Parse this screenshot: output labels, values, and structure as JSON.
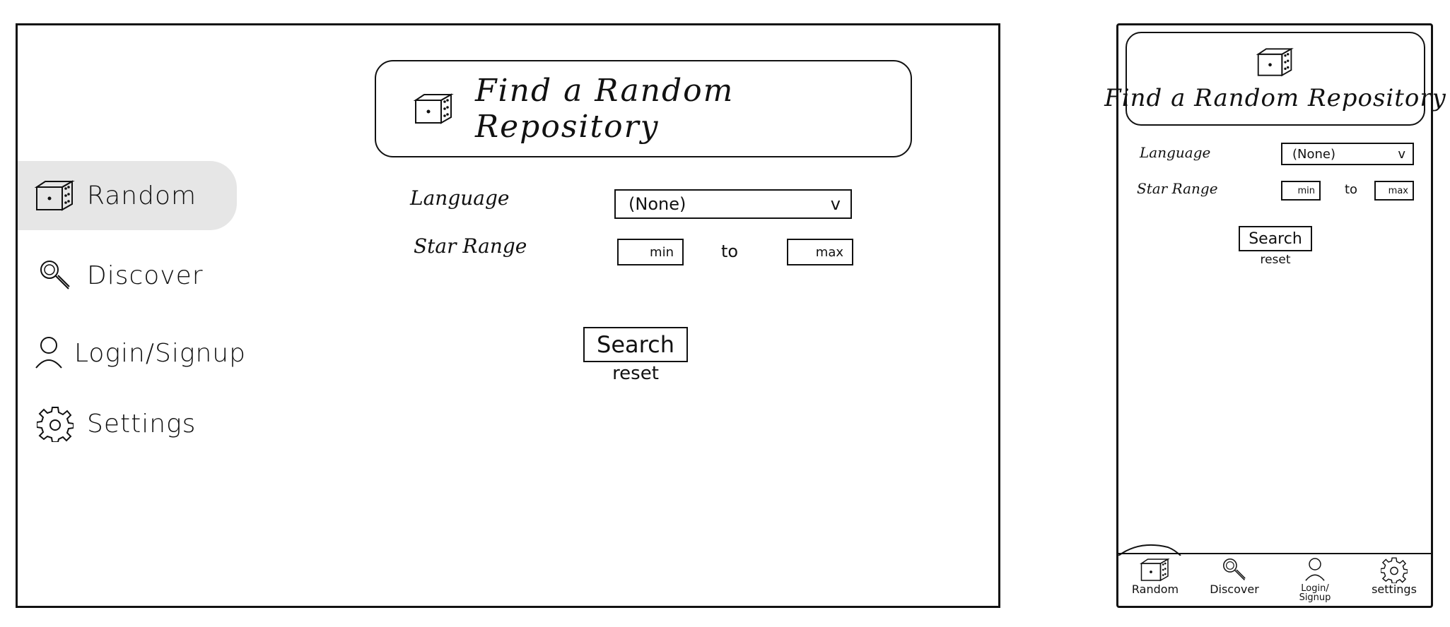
{
  "desktop": {
    "sidebar": {
      "items": [
        {
          "label": "Random",
          "icon": "dice-icon",
          "active": true
        },
        {
          "label": "Discover",
          "icon": "search-icon",
          "active": false
        },
        {
          "label": "Login/Signup",
          "icon": "user-icon",
          "active": false
        },
        {
          "label": "Settings",
          "icon": "gear-icon",
          "active": false
        }
      ]
    },
    "title": "Find a Random Repository",
    "form": {
      "language_label": "Language",
      "language_value": "(None)",
      "language_chevron": "v",
      "star_range_label": "Star Range",
      "min_placeholder": "min",
      "to_text": "to",
      "max_placeholder": "max",
      "search_label": "Search",
      "reset_label": "reset"
    },
    "colors": {
      "active_item_bg": "#e6e6e6",
      "stroke": "#111111"
    }
  },
  "mobile": {
    "title": "Find a Random Repository",
    "form": {
      "language_label": "Language",
      "language_value": "(None)",
      "language_chevron": "v",
      "star_range_label": "Star Range",
      "min_placeholder": "min",
      "to_text": "to",
      "max_placeholder": "max",
      "search_label": "Search",
      "reset_label": "reset"
    },
    "nav": {
      "items": [
        {
          "label": "Random",
          "icon": "dice-icon",
          "active": true
        },
        {
          "label": "Discover",
          "icon": "search-icon",
          "active": false
        },
        {
          "label": "Login/\nSignup",
          "icon": "user-icon",
          "active": false
        },
        {
          "label": "settings",
          "icon": "gear-icon",
          "active": false
        }
      ]
    }
  }
}
